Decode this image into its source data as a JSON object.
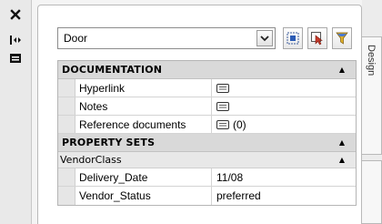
{
  "toolbar": {
    "close_icon": "close-icon",
    "auto_hide_icon": "auto-hide-icon",
    "properties_icon": "properties-icon"
  },
  "style_selector": {
    "value": "Door",
    "buttons": [
      "toggle-value-icon",
      "select-objects-icon",
      "quick-select-icon"
    ]
  },
  "categories": [
    {
      "title": "DOCUMENTATION",
      "rows": [
        {
          "name": "Hyperlink",
          "value": "",
          "icon": "note-icon"
        },
        {
          "name": "Notes",
          "value": "",
          "icon": "note-icon"
        },
        {
          "name": "Reference documents",
          "value": "(0)",
          "icon": "note-icon"
        }
      ]
    },
    {
      "title": "PROPERTY SETS",
      "subgroup": "VendorClass",
      "rows": [
        {
          "name": "Delivery_Date",
          "value": "11/08"
        },
        {
          "name": "Vendor_Status",
          "value": "preferred"
        }
      ]
    }
  ],
  "side_tabs": {
    "design_label": "Design"
  },
  "colors": {
    "category_bg": "#d9d9d9",
    "subgroup_bg": "#e8e8e8",
    "gutter_bg": "#e6e6e6"
  }
}
